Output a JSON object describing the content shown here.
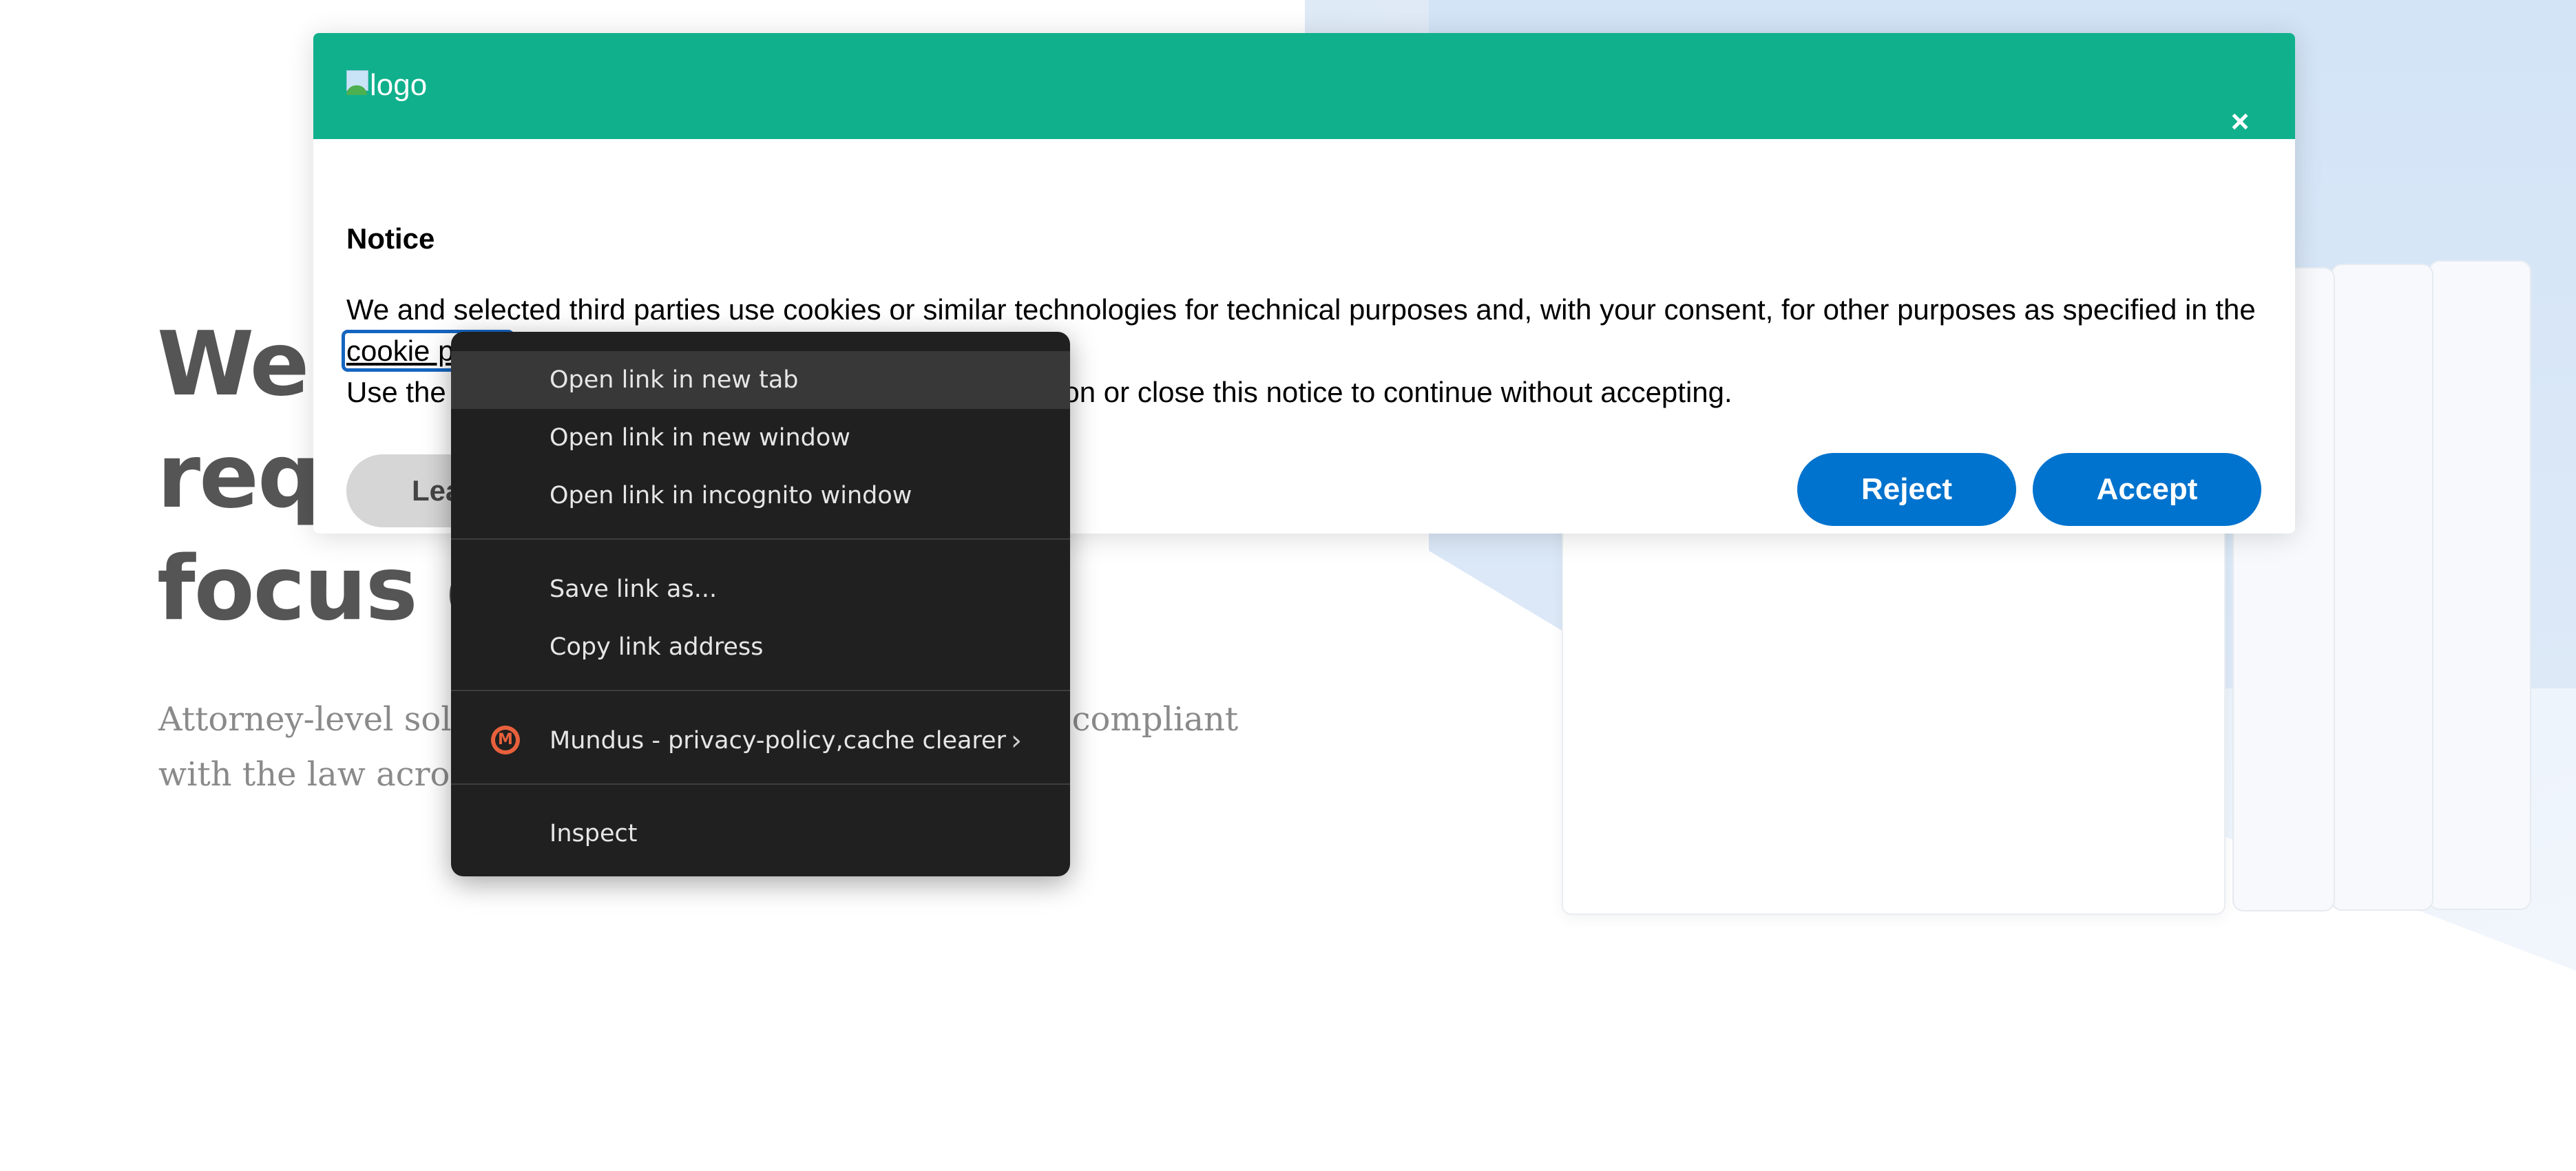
{
  "hero": {
    "title_lines": [
      "We",
      "requ",
      "focus o"
    ],
    "subtitle_lines": [
      "Attorney-level solu",
      "compliant",
      "with the law across"
    ]
  },
  "dialog": {
    "logo_alt": "logo",
    "close_symbol": "×",
    "notice_title": "Notice",
    "body_text_1": "We and selected third parties use cookies or similar technologies for technical purposes and, with your consent, for other purposes as specified in the",
    "link_text": "cookie policy",
    "link_suffix": ".",
    "body_text_2_start": "Use the",
    "body_text_2_end": "ton or close this notice to continue without accepting.",
    "learn_more_label": "Lea",
    "reject_label": "Reject",
    "accept_label": "Accept",
    "header_color": "#10b08c",
    "button_color": "#0073ce"
  },
  "context_menu": {
    "items": [
      {
        "label": "Open link in new tab"
      },
      {
        "label": "Open link in new window"
      },
      {
        "label": "Open link in incognito window"
      },
      {
        "label": "Save link as..."
      },
      {
        "label": "Copy link address"
      },
      {
        "label": "Mundus - privacy-policy,cache clearer",
        "icon": "mundus-extension-icon",
        "submenu": true
      },
      {
        "label": "Inspect"
      }
    ],
    "submenu_arrow": "›"
  }
}
